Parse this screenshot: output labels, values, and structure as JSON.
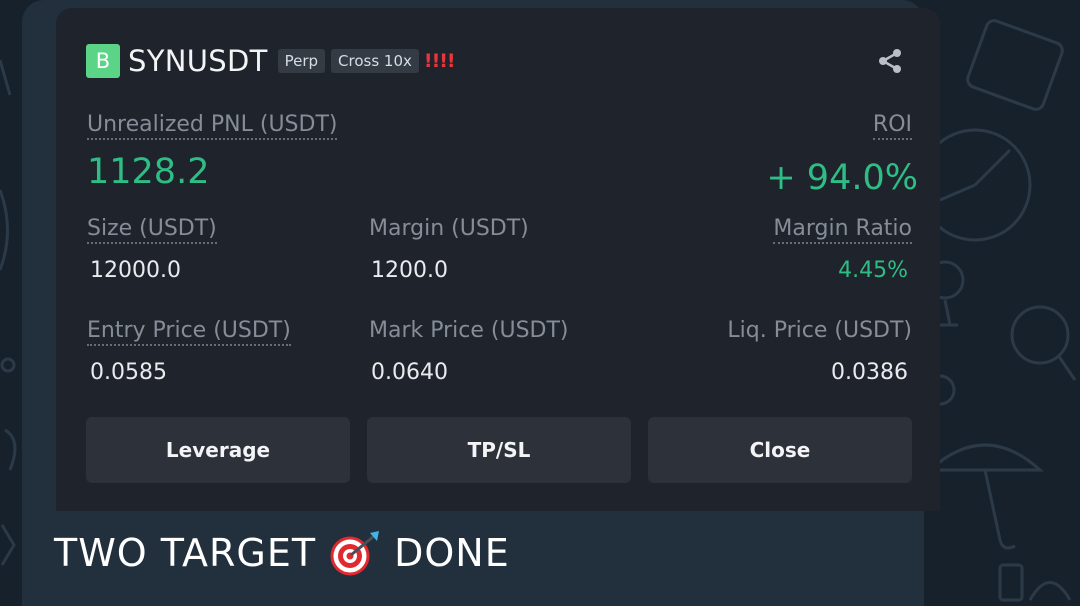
{
  "position": {
    "exchange_badge": "B",
    "symbol": "SYNUSDT",
    "tags": [
      "Perp",
      "Cross 10x"
    ],
    "warning": "!!!!",
    "unrealized_pnl_label": "Unrealized PNL (USDT)",
    "unrealized_pnl": "1128.2",
    "roi_label": "ROI",
    "roi": "+ 94.0%",
    "size_label": "Size (USDT)",
    "size": "12000.0",
    "margin_label": "Margin (USDT)",
    "margin": "1200.0",
    "margin_ratio_label": "Margin Ratio",
    "margin_ratio": "4.45%",
    "entry_price_label": "Entry Price (USDT)",
    "entry_price": "0.0585",
    "mark_price_label": "Mark Price (USDT)",
    "mark_price": "0.0640",
    "liq_price_label": "Liq. Price (USDT)",
    "liq_price": "0.0386"
  },
  "actions": {
    "leverage": "Leverage",
    "tpsl": "TP/SL",
    "close": "Close"
  },
  "message": {
    "caption_before": "TWO TARGET",
    "caption_after": "DONE",
    "emoji_icon": "direct-hit-target-icon"
  },
  "colors": {
    "profit_green": "#2dbd85",
    "warning_red": "#e8363b",
    "exchange_badge_green": "#5bd487",
    "card_bg": "#1f242c",
    "chat_bg": "#17212b"
  }
}
